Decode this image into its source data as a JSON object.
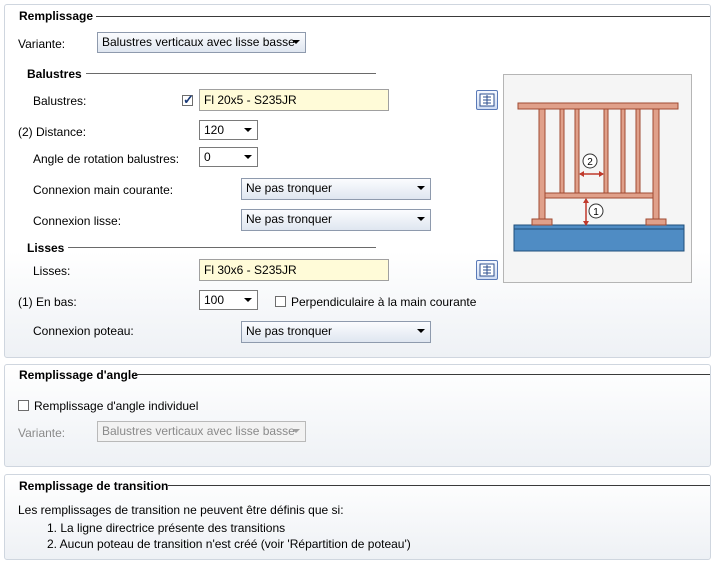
{
  "remplissage": {
    "title": "Remplissage",
    "variante_label": "Variante:",
    "variante_value": "Balustres verticaux avec lisse basse",
    "balustres_section": "Balustres",
    "balustres_label": "Balustres:",
    "balustres_value": "Fl 20x5 - S235JR",
    "balustres_checked": true,
    "distance_label": "(2) Distance:",
    "distance_value": "120",
    "angle_label": "Angle de rotation balustres:",
    "angle_value": "0",
    "connexion_main_label": "Connexion main courante:",
    "connexion_main_value": "Ne pas tronquer",
    "connexion_lisse_label": "Connexion lisse:",
    "connexion_lisse_value": "Ne pas tronquer",
    "lisses_section": "Lisses",
    "lisses_label": "Lisses:",
    "lisses_value": "Fl 30x6 - S235JR",
    "en_bas_label": "(1) En bas:",
    "en_bas_value": "100",
    "perpendiculaire_label": "Perpendiculaire à la main courante",
    "perpendiculaire_checked": false,
    "connexion_poteau_label": "Connexion poteau:",
    "connexion_poteau_value": "Ne pas tronquer",
    "preview": {
      "marker_1": "1",
      "marker_2": "2"
    }
  },
  "angle": {
    "title": "Remplissage d'angle",
    "individuel_label": "Remplissage d'angle individuel",
    "individuel_checked": false,
    "variante_label": "Variante:",
    "variante_value": "Balustres verticaux avec lisse basse"
  },
  "transition": {
    "title": "Remplissage de transition",
    "intro": "Les remplissages de transition ne peuvent être définis que si:",
    "item1": "1. La ligne directrice présente des transitions",
    "item2": "2. Aucun poteau de transition n'est créé (voir 'Répartition de poteau')"
  },
  "colors": {
    "rail": "#e0a08a",
    "rail_stroke": "#a04a32",
    "floor": "#4f8cc4",
    "dimension": "#c0392b"
  },
  "icons": {
    "library": "catalog-book-icon",
    "dropdown": "chevron-down-icon"
  }
}
